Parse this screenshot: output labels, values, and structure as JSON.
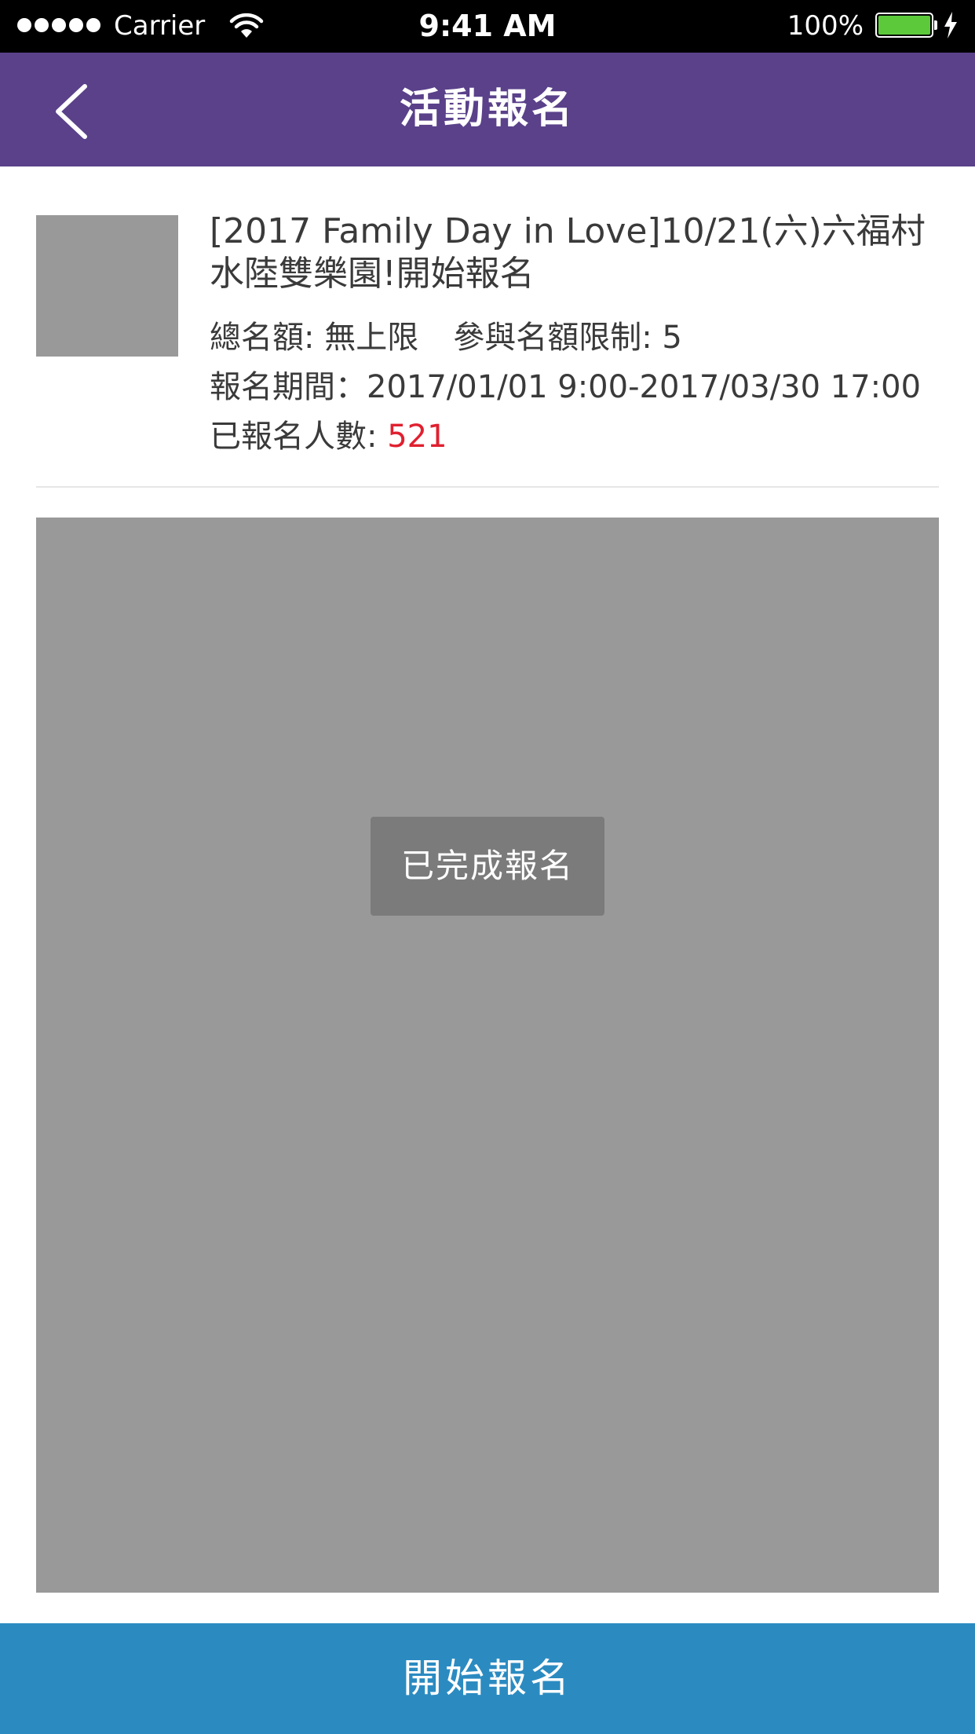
{
  "status_bar": {
    "carrier": "Carrier",
    "time": "9:41 AM",
    "battery_percent": "100%",
    "battery_level": 1.0,
    "battery_color": "#5cc93b",
    "signal_bars": 5
  },
  "nav": {
    "title": "活動報名",
    "back_icon": "chevron-left-icon",
    "background": "#5a418a"
  },
  "event": {
    "title": "[2017 Family Day in Love]10/21(六)六福村水陸雙樂園!開始報名",
    "quota_label": "總名額: 無上限",
    "limit_label": "參與名額限制: 5",
    "period_label": "報名期間：2017/01/01 9:00-2017/03/30 17:00",
    "registered_label": "已報名人數: ",
    "registered_count": "521"
  },
  "main": {
    "status_text": "已完成報名"
  },
  "footer": {
    "button_label": "開始報名",
    "button_color": "#2b8bc1"
  }
}
